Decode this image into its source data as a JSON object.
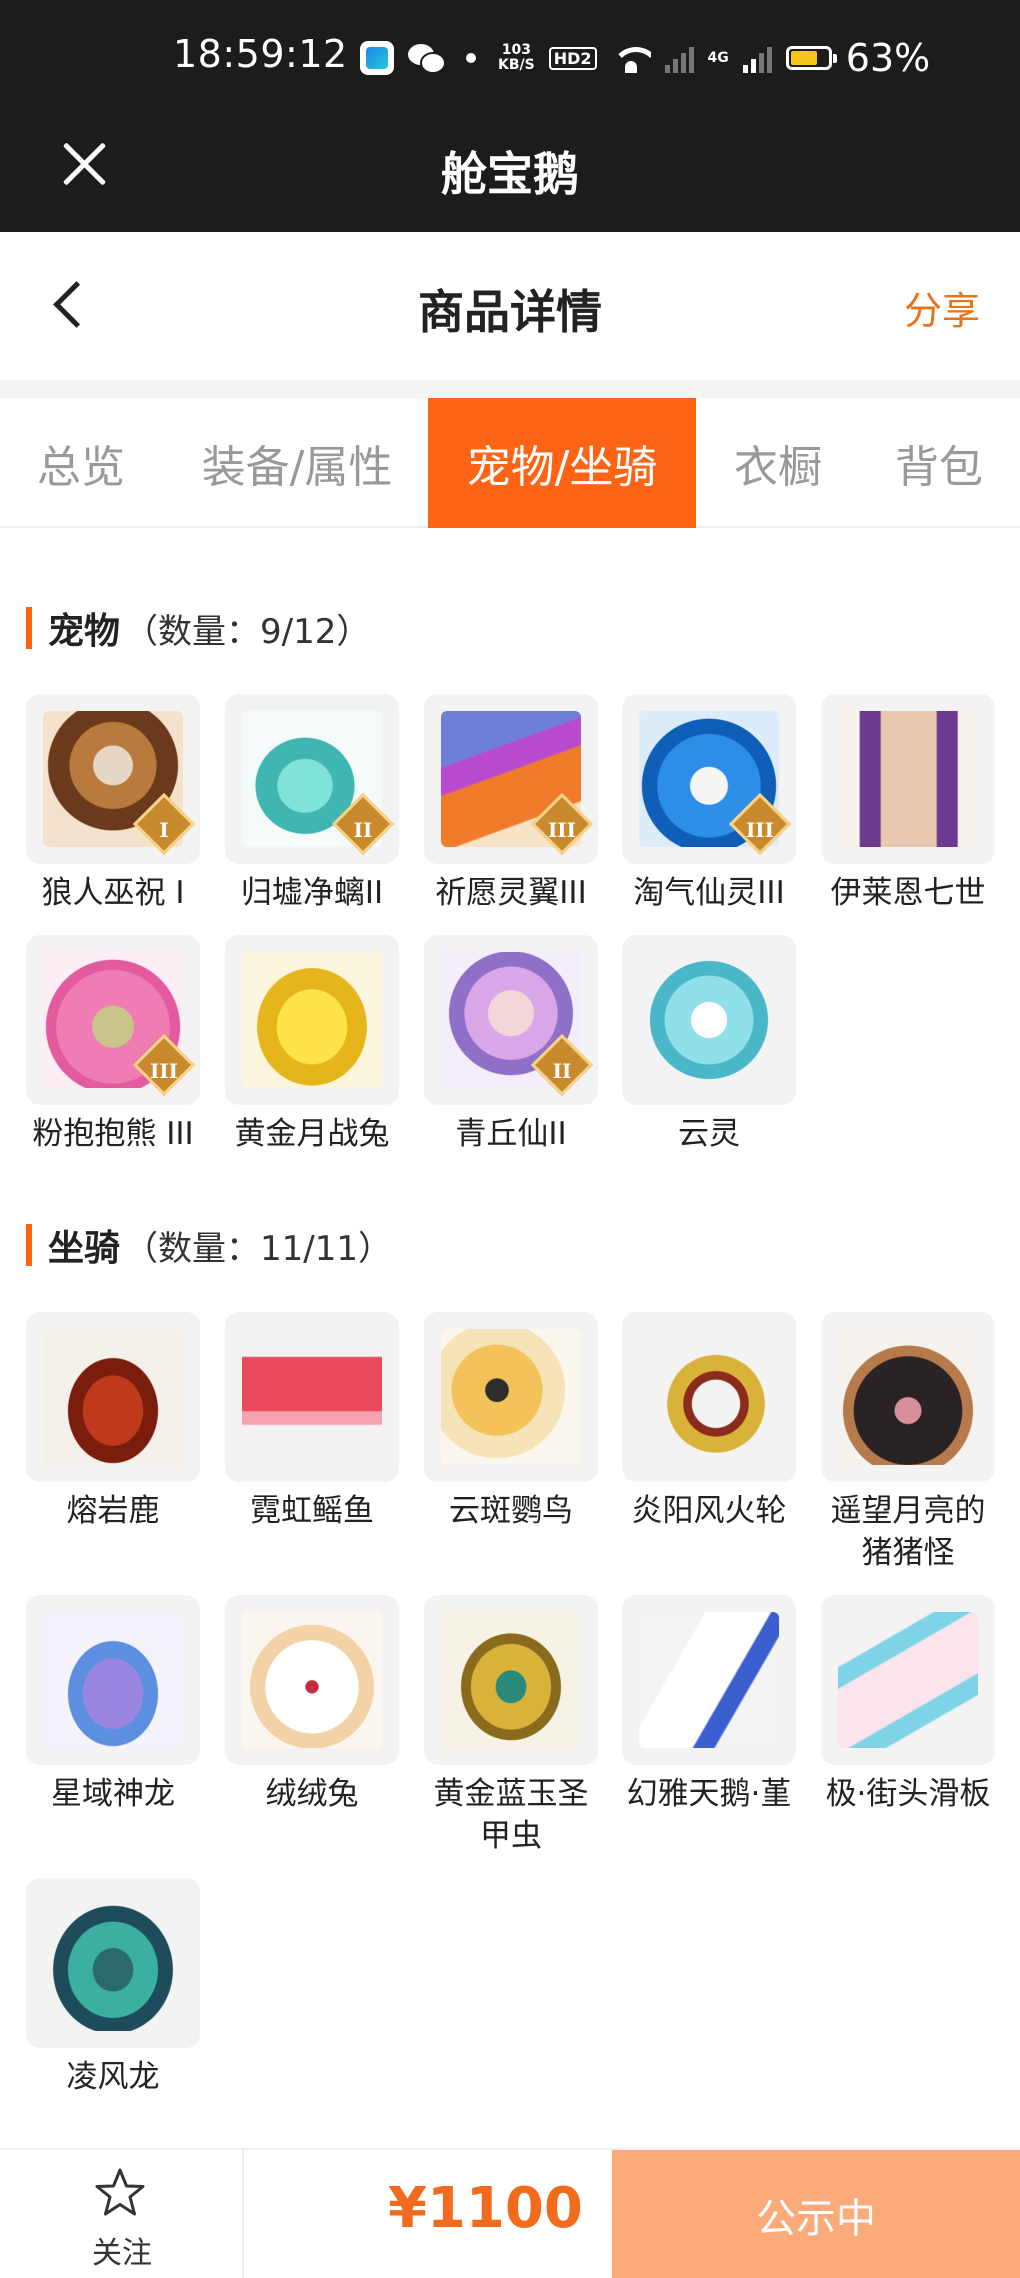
{
  "status_bar": {
    "time": "18:59:12",
    "net_speed_value": "103",
    "net_speed_unit": "KB/S",
    "hd_badge": "HD2",
    "network": "4G",
    "battery_percent": "63%"
  },
  "app_bar": {
    "title": "舱宝鹅"
  },
  "page_header": {
    "title": "商品详情",
    "share_label": "分享"
  },
  "tabs": [
    {
      "label": "总览",
      "active": false
    },
    {
      "label": "装备/属性",
      "active": false
    },
    {
      "label": "宠物/坐骑",
      "active": true
    },
    {
      "label": "衣橱",
      "active": false
    },
    {
      "label": "背包",
      "active": false
    }
  ],
  "pets_section": {
    "title": "宠物",
    "count_text": "（数量：9/12）",
    "items": [
      {
        "name": "狼人巫祝 I",
        "tier": "I",
        "icon": "werewolf-pet-icon"
      },
      {
        "name": "归墟净螭II",
        "tier": "II",
        "icon": "dragon-pet-icon"
      },
      {
        "name": "祈愿灵翼III",
        "tier": "III",
        "icon": "bird-pet-icon"
      },
      {
        "name": "淘气仙灵III",
        "tier": "III",
        "icon": "puppy-pet-icon"
      },
      {
        "name": "伊莱恩七世",
        "tier": "",
        "icon": "priestess-pet-icon"
      },
      {
        "name": "粉抱抱熊 III",
        "tier": "III",
        "icon": "bear-pet-icon"
      },
      {
        "name": "黄金月战兔",
        "tier": "",
        "icon": "rabbit-pet-icon"
      },
      {
        "name": "青丘仙II",
        "tier": "II",
        "icon": "fox-spirit-pet-icon"
      },
      {
        "name": "云灵",
        "tier": "",
        "icon": "cloud-spirit-pet-icon"
      }
    ]
  },
  "mounts_section": {
    "title": "坐骑",
    "count_text": "（数量：11/11）",
    "items": [
      {
        "name": "熔岩鹿",
        "icon": "deer-mount-icon"
      },
      {
        "name": "霓虹鳐鱼",
        "icon": "ray-mount-icon"
      },
      {
        "name": "云斑鹦鸟",
        "icon": "parrot-mount-icon"
      },
      {
        "name": "炎阳风火轮",
        "icon": "wheel-mount-icon"
      },
      {
        "name": "遥望月亮的猪猪怪",
        "icon": "pig-mount-icon"
      },
      {
        "name": "星域神龙",
        "icon": "star-dragon-mount-icon"
      },
      {
        "name": "绒绒兔",
        "icon": "fluffy-rabbit-mount-icon"
      },
      {
        "name": "黄金蓝玉圣甲虫",
        "icon": "scarab-mount-icon"
      },
      {
        "name": "幻雅天鹅·堇",
        "icon": "swan-mount-icon"
      },
      {
        "name": "极·街头滑板",
        "icon": "skateboard-mount-icon"
      },
      {
        "name": "凌风龙",
        "icon": "wind-dragon-mount-icon"
      }
    ]
  },
  "bottom_bar": {
    "follow_label": "关注",
    "price": "¥1100",
    "status_label": "公示中"
  },
  "colors": {
    "accent": "#ff6414",
    "share_text": "#e8731d",
    "price_text": "#f26b1d",
    "status_button": "#fdaa7a"
  }
}
